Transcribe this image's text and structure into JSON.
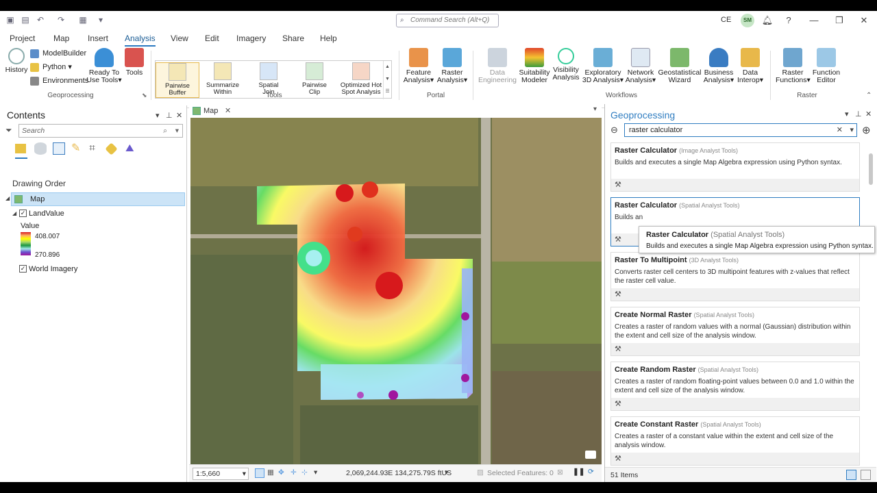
{
  "titlebar": {
    "command_search": "Command Search (Alt+Q)",
    "user_initials": "CE",
    "avatar": "SM"
  },
  "ribbon_tabs": [
    "Project",
    "Map",
    "Insert",
    "Analysis",
    "View",
    "Edit",
    "Imagery",
    "Share",
    "Help"
  ],
  "active_tab": "Analysis",
  "ribbon": {
    "geoprocessing": {
      "label": "Geoprocessing",
      "history": "History",
      "modelbuilder": "ModelBuilder",
      "python": "Python",
      "environments": "Environments",
      "ready_to_use": [
        "Ready To",
        "Use Tools"
      ],
      "tools": "Tools"
    },
    "tools_group": {
      "label": "Tools",
      "items": [
        [
          "Pairwise",
          "Buffer"
        ],
        [
          "Summarize",
          "Within"
        ],
        [
          "Spatial",
          "Join"
        ],
        [
          "Pairwise",
          "Clip"
        ],
        [
          "Optimized Hot",
          "Spot Analysis"
        ]
      ]
    },
    "portal": {
      "label": "Portal",
      "items": [
        [
          "Feature",
          "Analysis"
        ],
        [
          "Raster",
          "Analysis"
        ]
      ]
    },
    "workflows": {
      "label": "Workflows",
      "items": [
        [
          "Data",
          "Engineering"
        ],
        [
          "Suitability",
          "Modeler"
        ],
        [
          "Visibility",
          "Analysis"
        ],
        [
          "Exploratory",
          "3D Analysis"
        ],
        [
          "Network",
          "Analysis"
        ],
        [
          "Geostatistical",
          "Wizard"
        ],
        [
          "Business",
          "Analysis"
        ],
        [
          "Data",
          "Interop"
        ]
      ]
    },
    "raster": {
      "label": "Raster",
      "items": [
        [
          "Raster",
          "Functions"
        ],
        [
          "Function",
          "Editor"
        ]
      ]
    }
  },
  "contents": {
    "title": "Contents",
    "search_placeholder": "Search",
    "drawing_order": "Drawing Order",
    "map_name": "Map",
    "layers": {
      "landvalue": "LandValue",
      "value_label": "Value",
      "max": "408.007",
      "min": "270.896",
      "imagery": "World Imagery"
    }
  },
  "map": {
    "tab": "Map",
    "scale": "1:5,660",
    "coordinates": "2,069,244.93E 134,275.79S ftUS",
    "selected_features": "Selected Features: 0"
  },
  "geoprocessing": {
    "title": "Geoprocessing",
    "search_value": "raster calculator",
    "results": [
      {
        "title": "Raster Calculator",
        "source": "(Image Analyst Tools)",
        "desc": "Builds and executes a single Map Algebra expression using Python syntax."
      },
      {
        "title": "Raster Calculator",
        "source": "(Spatial Analyst Tools)",
        "desc": "Builds and executes a single Map Algebra expression using Python syntax."
      },
      {
        "title": "Raster To Multipoint",
        "source": "(3D Analyst Tools)",
        "desc": "Converts raster cell centers to 3D multipoint features with z-values that reflect the raster cell value."
      },
      {
        "title": "Create Normal Raster",
        "source": "(Spatial Analyst Tools)",
        "desc": "Creates a raster of random values with a normal (Gaussian) distribution within the extent and cell size of the analysis window."
      },
      {
        "title": "Create Random Raster",
        "source": "(Spatial Analyst Tools)",
        "desc": "Creates a raster of random floating-point values between 0.0 and 1.0 within the extent and cell size of the analysis window."
      },
      {
        "title": "Create Constant Raster",
        "source": "(Spatial Analyst Tools)",
        "desc": "Creates a raster of a constant value within the extent and cell size of the analysis window."
      }
    ],
    "result_visible_desc_1": "Builds an",
    "tooltip": {
      "title": "Raster Calculator",
      "source": "(Spatial Analyst Tools)",
      "desc": "Builds and executes a single Map Algebra expression using Python syntax."
    },
    "count": "51 Items"
  }
}
